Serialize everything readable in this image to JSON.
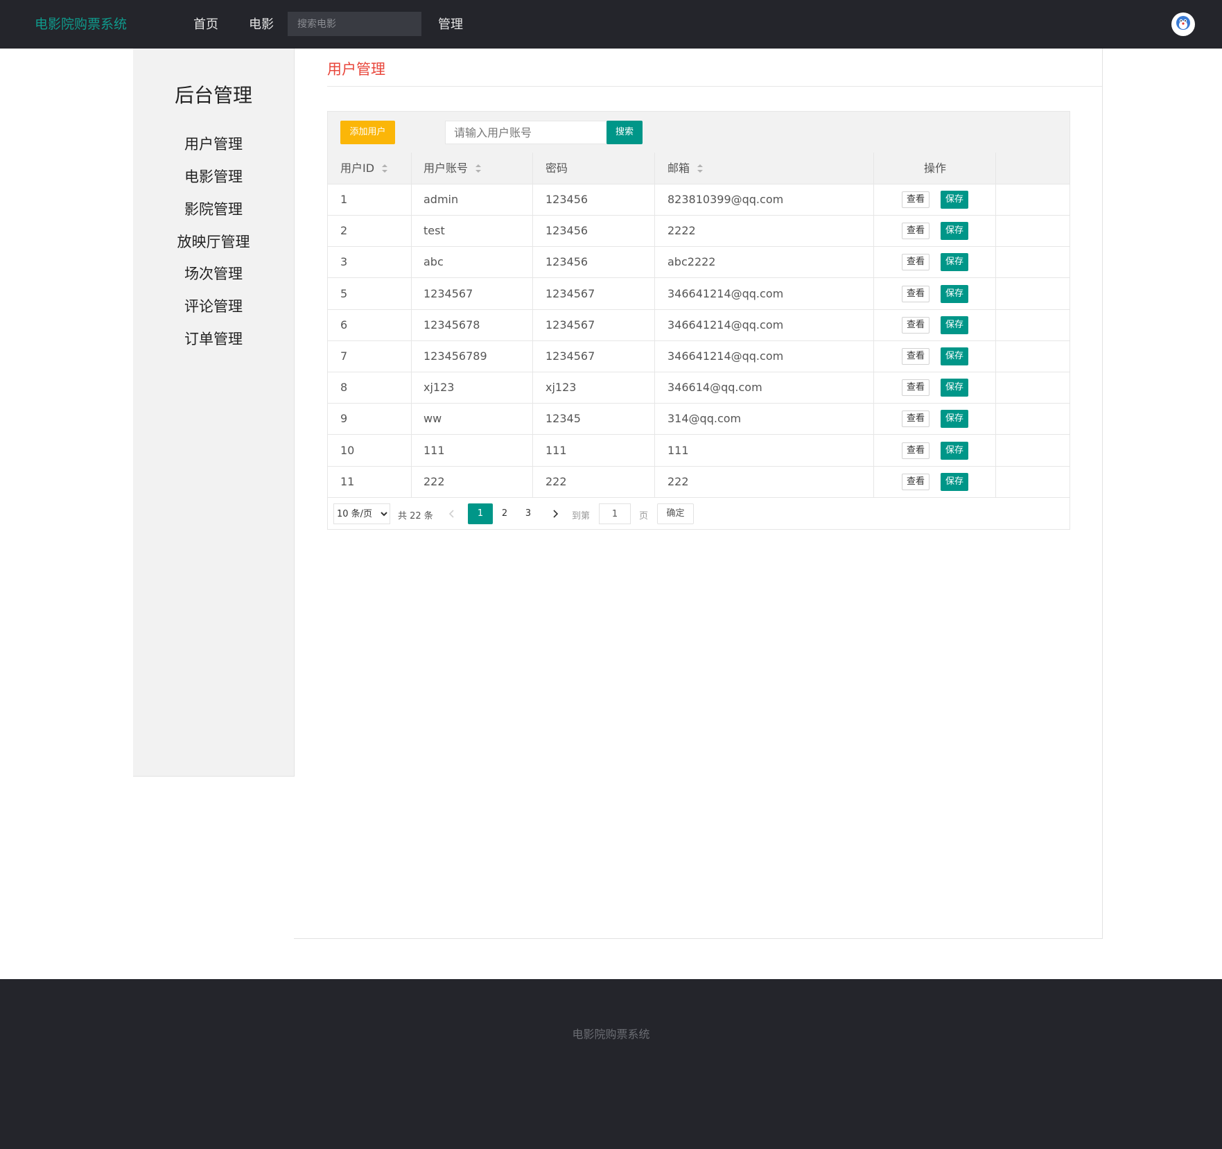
{
  "brand": "电影院购票系统",
  "nav": {
    "items": [
      "首页",
      "电影",
      "管理"
    ],
    "search_placeholder": "搜索电影"
  },
  "sidebar": {
    "title": "后台管理",
    "items": [
      "用户管理",
      "电影管理",
      "影院管理",
      "放映厅管理",
      "场次管理",
      "评论管理",
      "订单管理"
    ]
  },
  "main": {
    "title": "用户管理",
    "toolbar": {
      "add_label": "添加用户",
      "search_placeholder": "请输入用户账号",
      "search_label": "搜索"
    },
    "table": {
      "headers": [
        "用户ID",
        "用户账号",
        "密码",
        "邮箱",
        "操作"
      ],
      "sortable": [
        true,
        true,
        false,
        true,
        false
      ],
      "rows": [
        [
          "1",
          "admin",
          "123456",
          "823810399@qq.com"
        ],
        [
          "2",
          "test",
          "123456",
          "2222"
        ],
        [
          "3",
          "abc",
          "123456",
          "abc2222"
        ],
        [
          "5",
          "1234567",
          "1234567",
          "346641214@qq.com"
        ],
        [
          "6",
          "12345678",
          "1234567",
          "346641214@qq.com"
        ],
        [
          "7",
          "123456789",
          "1234567",
          "346641214@qq.com"
        ],
        [
          "8",
          "xj123",
          "xj123",
          "346614@qq.com"
        ],
        [
          "9",
          "ww",
          "12345",
          "314@qq.com"
        ],
        [
          "10",
          "111",
          "111",
          "111"
        ],
        [
          "11",
          "222",
          "222",
          "222"
        ]
      ],
      "view_label": "查看",
      "save_label": "保存"
    },
    "pagination": {
      "page_size": "10 条/页",
      "total": "共 22 条",
      "pages": [
        "1",
        "2",
        "3"
      ],
      "current": "1",
      "goto_prefix": "到第",
      "goto_value": "1",
      "goto_suffix": "页",
      "confirm": "确定"
    }
  },
  "footer": {
    "text": "电影院购票系统"
  },
  "colors": {
    "topbar": "#24252b",
    "brand": "#0f9a8c",
    "accent": "#009688",
    "warning": "#fbb608",
    "title_red": "#e8463b",
    "sidebar_bg": "#f2f2f2"
  }
}
